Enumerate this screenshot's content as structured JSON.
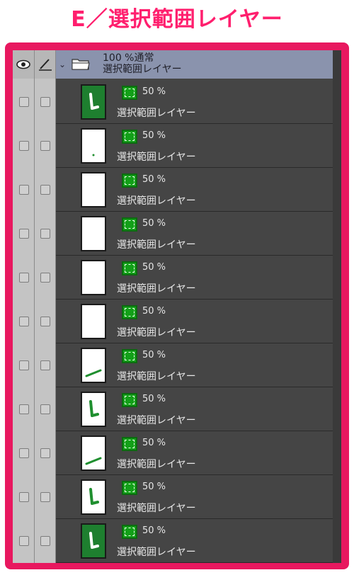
{
  "page_title": "E／選択範囲レイヤー",
  "folder": {
    "blend": "100 %通常",
    "name": "選択範囲レイヤー",
    "icons": {
      "visibility": "eye-icon",
      "edit": "pen-icon",
      "expand": "chevron-down-icon",
      "folder": "folder-icon"
    }
  },
  "layers": [
    {
      "opacity": "50 %",
      "name": "選択範囲レイヤー",
      "thumb": "dark-L"
    },
    {
      "opacity": "50 %",
      "name": "選択範囲レイヤー",
      "thumb": "white-dot"
    },
    {
      "opacity": "50 %",
      "name": "選択範囲レイヤー",
      "thumb": "white"
    },
    {
      "opacity": "50 %",
      "name": "選択範囲レイヤー",
      "thumb": "white"
    },
    {
      "opacity": "50 %",
      "name": "選択範囲レイヤー",
      "thumb": "white"
    },
    {
      "opacity": "50 %",
      "name": "選択範囲レイヤー",
      "thumb": "white"
    },
    {
      "opacity": "50 %",
      "name": "選択範囲レイヤー",
      "thumb": "white-stroke"
    },
    {
      "opacity": "50 %",
      "name": "選択範囲レイヤー",
      "thumb": "white-L"
    },
    {
      "opacity": "50 %",
      "name": "選択範囲レイヤー",
      "thumb": "white-stroke"
    },
    {
      "opacity": "50 %",
      "name": "選択範囲レイヤー",
      "thumb": "white-L"
    },
    {
      "opacity": "50 %",
      "name": "選択範囲レイヤー",
      "thumb": "dark-L"
    }
  ],
  "colors": {
    "accent": "#ff1f6e",
    "frame": "#e8185f",
    "selection_green": "#13a019",
    "folder_bg": "#8a93ad"
  }
}
